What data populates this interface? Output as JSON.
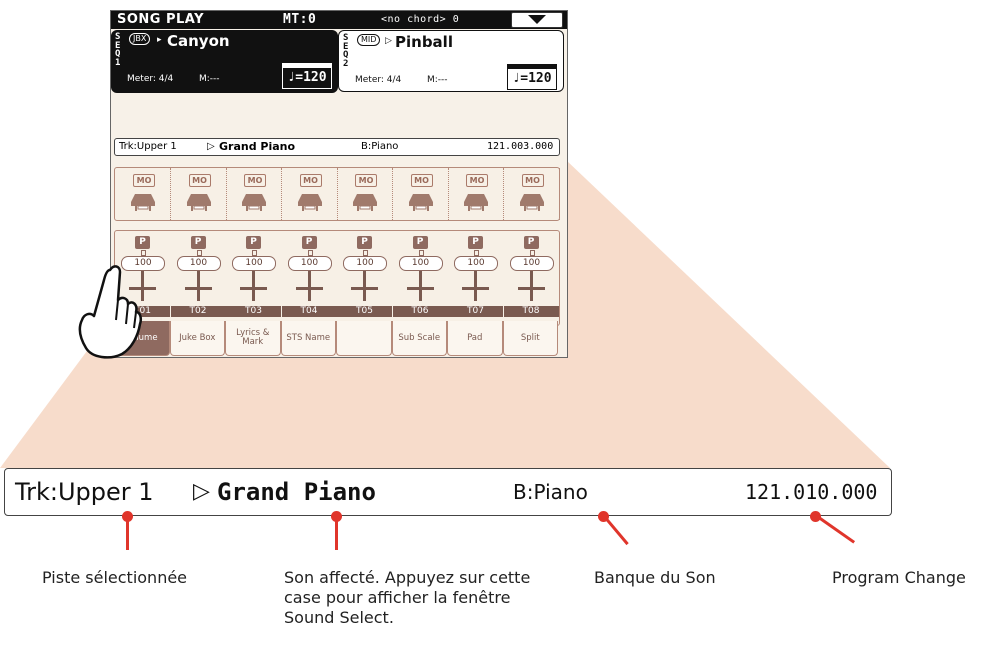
{
  "screen": {
    "title": "SONG PLAY",
    "mt": "MT:0",
    "chord": "<no chord> 0",
    "seq1": {
      "label": "S\nE\nQ\n1",
      "source": "JBX",
      "song": "Canyon",
      "meter": "Meter: 4/4",
      "measure": "M:---",
      "tempo": "♩=120"
    },
    "seq2": {
      "label": "S\nE\nQ\n2",
      "source": "MID",
      "song": "Pinball",
      "meter": "Meter: 4/4",
      "measure": "M:---",
      "tempo": "♩=120"
    },
    "track_info": {
      "track": "Trk:Upper 1",
      "sound": "Grand Piano",
      "bank": "B:Piano",
      "program": "121.003.000"
    },
    "mute_label": "MO",
    "play_label": "P",
    "channels": [
      {
        "label": "T01",
        "volume": "100"
      },
      {
        "label": "T02",
        "volume": "100"
      },
      {
        "label": "T03",
        "volume": "100"
      },
      {
        "label": "T04",
        "volume": "100"
      },
      {
        "label": "T05",
        "volume": "100"
      },
      {
        "label": "T06",
        "volume": "100"
      },
      {
        "label": "T07",
        "volume": "100"
      },
      {
        "label": "T08",
        "volume": "100"
      }
    ],
    "tabs": [
      "Volume",
      "Juke Box",
      "Lyrics & Mark",
      "STS Name",
      "",
      "Sub Scale",
      "Pad",
      "Split"
    ]
  },
  "zoom": {
    "track": "Trk:Upper 1",
    "arrow": "▷",
    "sound": "Grand Piano",
    "bank": "B:Piano",
    "program": "121.010.000"
  },
  "captions": {
    "track": "Piste sélectionnée",
    "sound": "Son affecté. Appuyez sur cette case pour afficher la fenêtre Sound Select.",
    "bank": "Banque du Son",
    "program": "Program Change"
  },
  "colors": {
    "accent": "#e0352b",
    "zoom_fan": "#f6d8c6",
    "screen_bg": "#f7f1e8"
  }
}
